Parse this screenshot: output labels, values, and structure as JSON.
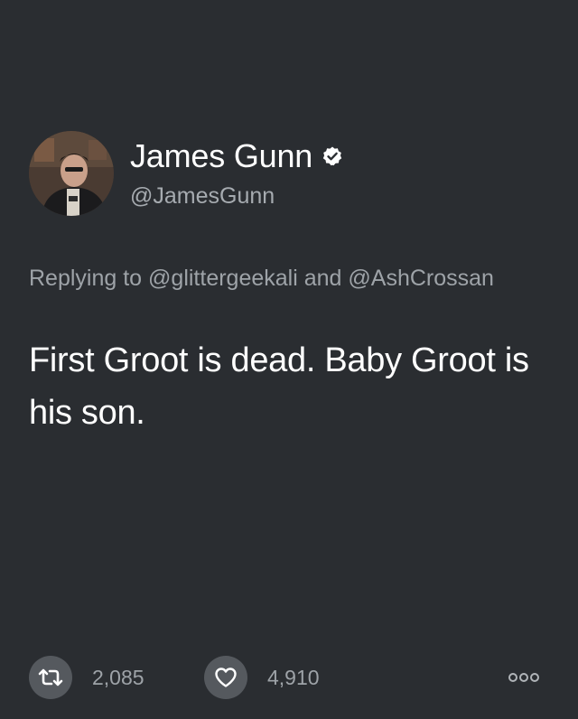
{
  "author": {
    "display_name": "James Gunn",
    "handle": "@JamesGunn",
    "verified": true
  },
  "reply": {
    "prefix": "Replying to",
    "mention_1": "@glittergeekali",
    "conjunction": "and",
    "mention_2": "@AshCrossan"
  },
  "tweet": {
    "text": "First Groot is dead. Baby Groot is his son."
  },
  "actions": {
    "retweet_count": "2,085",
    "like_count": "4,910"
  },
  "icons": {
    "verified": "verified-badge-icon",
    "retweet": "retweet-icon",
    "like": "heart-icon",
    "more": "more-icon"
  },
  "colors": {
    "background": "#2a2d31",
    "text_primary": "#ffffff",
    "text_secondary": "#9ea3a8",
    "action_circle": "#55595e"
  }
}
